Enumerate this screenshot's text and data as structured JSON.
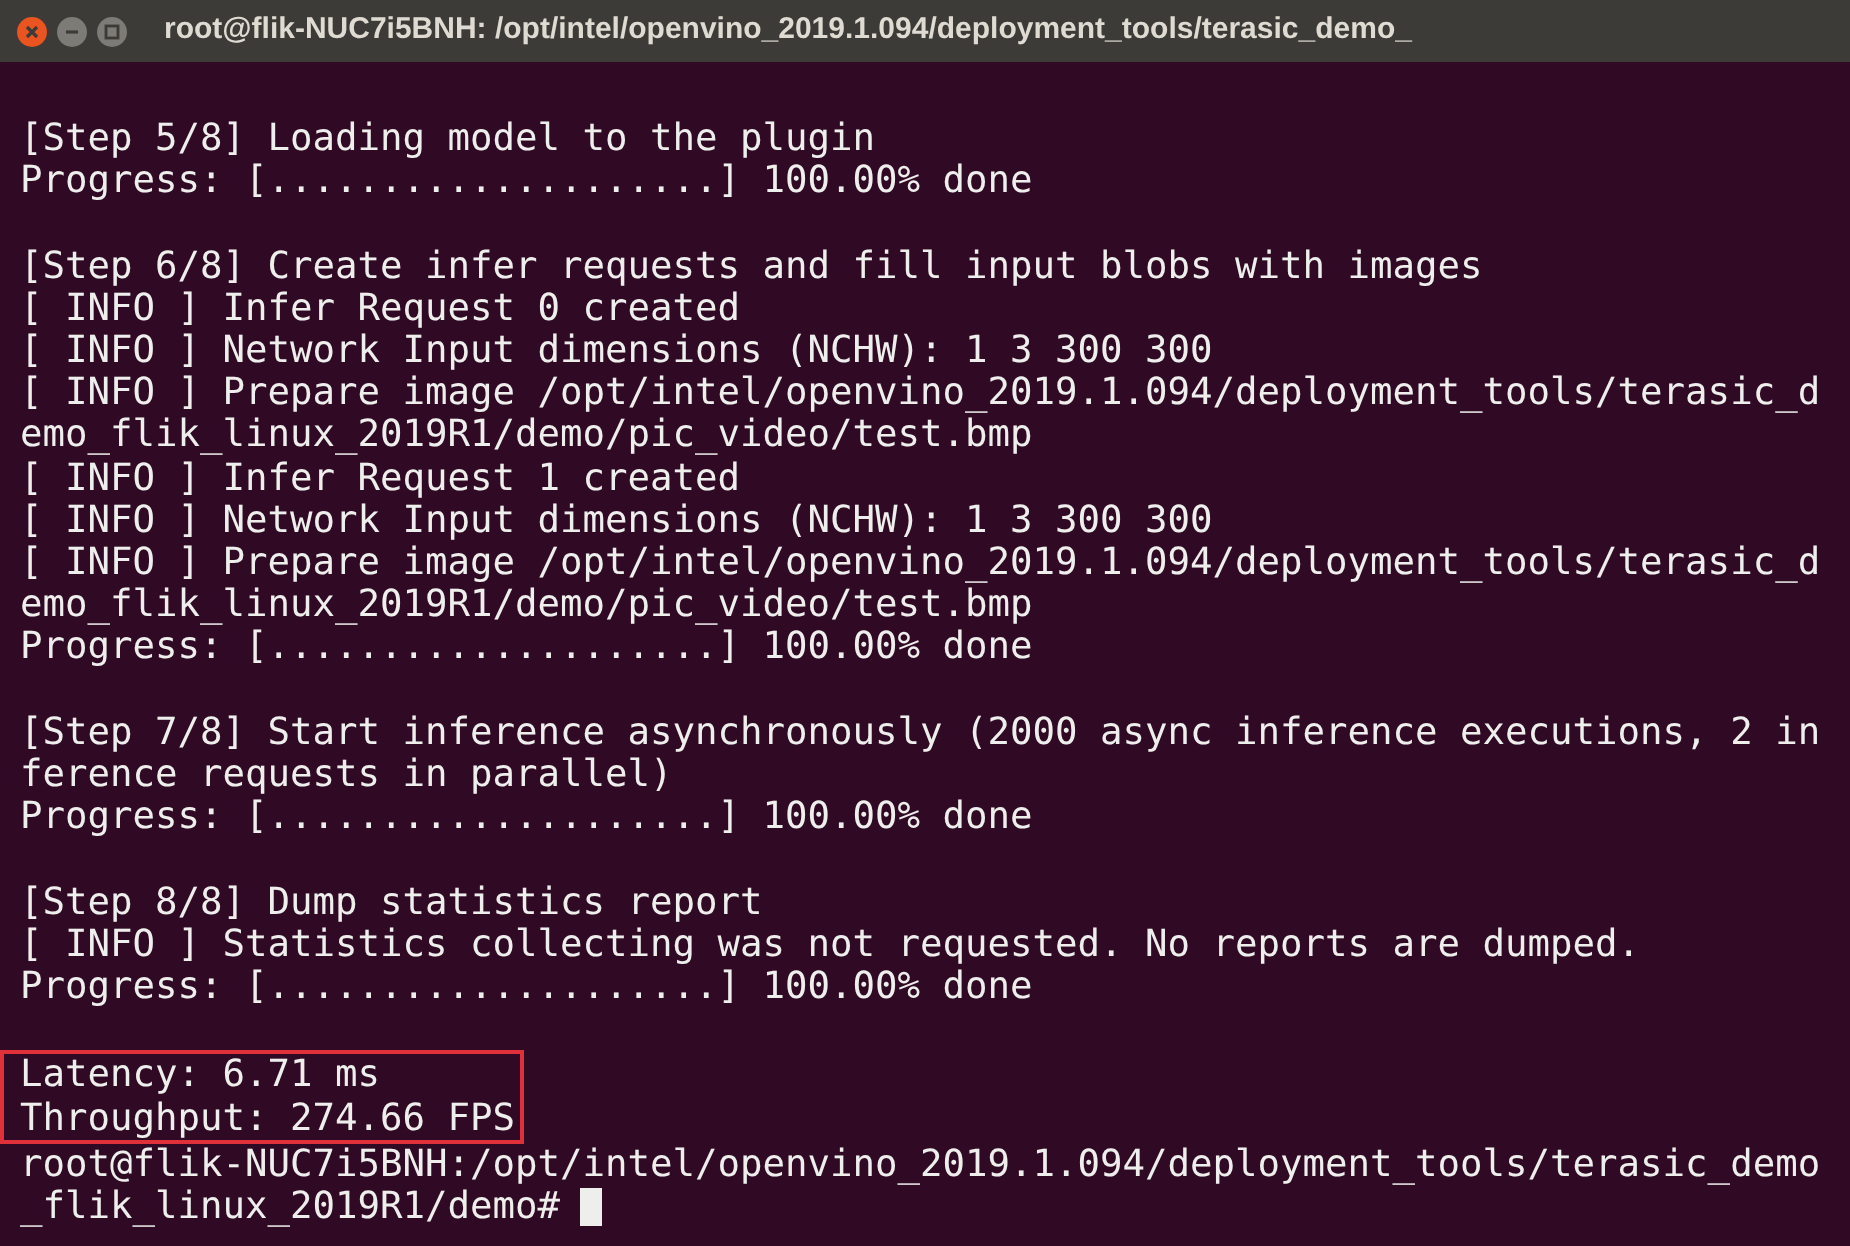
{
  "window": {
    "title": "root@flik-NUC7i5BNH: /opt/intel/openvino_2019.1.094/deployment_tools/terasic_demo_"
  },
  "terminal": {
    "blocks": [
      {
        "kind": "output",
        "lines": [
          "[Step 5/8] Loading model to the plugin",
          "Progress: [....................] 100.00% done"
        ]
      },
      {
        "kind": "output",
        "lines": [
          "[Step 6/8] Create infer requests and fill input blobs with images",
          "[ INFO ] Infer Request 0 created",
          "[ INFO ] Network Input dimensions (NCHW): 1 3 300 300",
          "[ INFO ] Prepare image /opt/intel/openvino_2019.1.094/deployment_tools/terasic_d",
          "emo_flik_linux_2019R1/demo/pic_video/test.bmp",
          "[ INFO ] Infer Request 1 created",
          "[ INFO ] Network Input dimensions (NCHW): 1 3 300 300",
          "[ INFO ] Prepare image /opt/intel/openvino_2019.1.094/deployment_tools/terasic_d",
          "emo_flik_linux_2019R1/demo/pic_video/test.bmp",
          "Progress: [....................] 100.00% done"
        ]
      },
      {
        "kind": "output",
        "lines": [
          "[Step 7/8] Start inference asynchronously (2000 async inference executions, 2 in",
          "ference requests in parallel)",
          "Progress: [....................] 100.00% done"
        ]
      },
      {
        "kind": "output",
        "lines": [
          "[Step 8/8] Dump statistics report",
          "[ INFO ] Statistics collecting was not requested. No reports are dumped.",
          "Progress: [....................] 100.00% done"
        ]
      },
      {
        "kind": "result",
        "lines": [
          "Latency: 6.71 ms",
          "Throughput: 274.66 FPS"
        ]
      },
      {
        "kind": "prompt",
        "lines": [
          "root@flik-NUC7i5BNH:/opt/intel/openvino_2019.1.094/deployment_tools/terasic_demo",
          "_flik_linux_2019R1/demo#"
        ]
      }
    ]
  }
}
